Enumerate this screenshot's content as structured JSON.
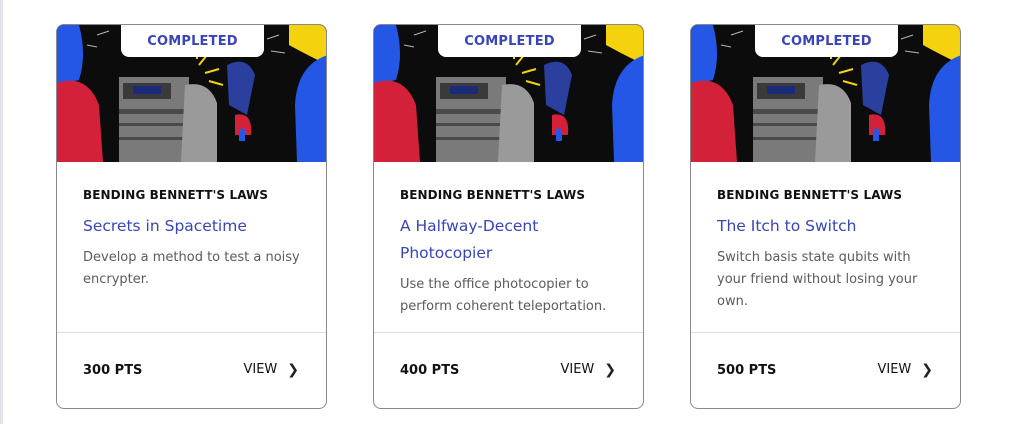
{
  "cards": [
    {
      "badge": "COMPLETED",
      "series": "BENDING BENNETT'S LAWS",
      "title": "Secrets in Spacetime",
      "description": "Develop a method to test a noisy encrypter.",
      "points": "300 PTS",
      "view_label": "VIEW",
      "icon": "chevron-right-icon"
    },
    {
      "badge": "COMPLETED",
      "series": "BENDING BENNETT'S LAWS",
      "title": "A Halfway-Decent Photocopier",
      "description": "Use the office photocopier to perform coherent teleportation.",
      "points": "400 PTS",
      "view_label": "VIEW",
      "icon": "chevron-right-icon"
    },
    {
      "badge": "COMPLETED",
      "series": "BENDING BENNETT'S LAWS",
      "title": "The Itch to Switch",
      "description": "Switch basis state qubits with your friend without losing your own.",
      "points": "500 PTS",
      "view_label": "VIEW",
      "icon": "chevron-right-icon"
    }
  ],
  "colors": {
    "accent": "#3a44b4",
    "red_figure": "#d4213a",
    "blue_figure": "#2457e6",
    "yellow_hair": "#f4d20e",
    "art_background": "#0c0c0c"
  }
}
